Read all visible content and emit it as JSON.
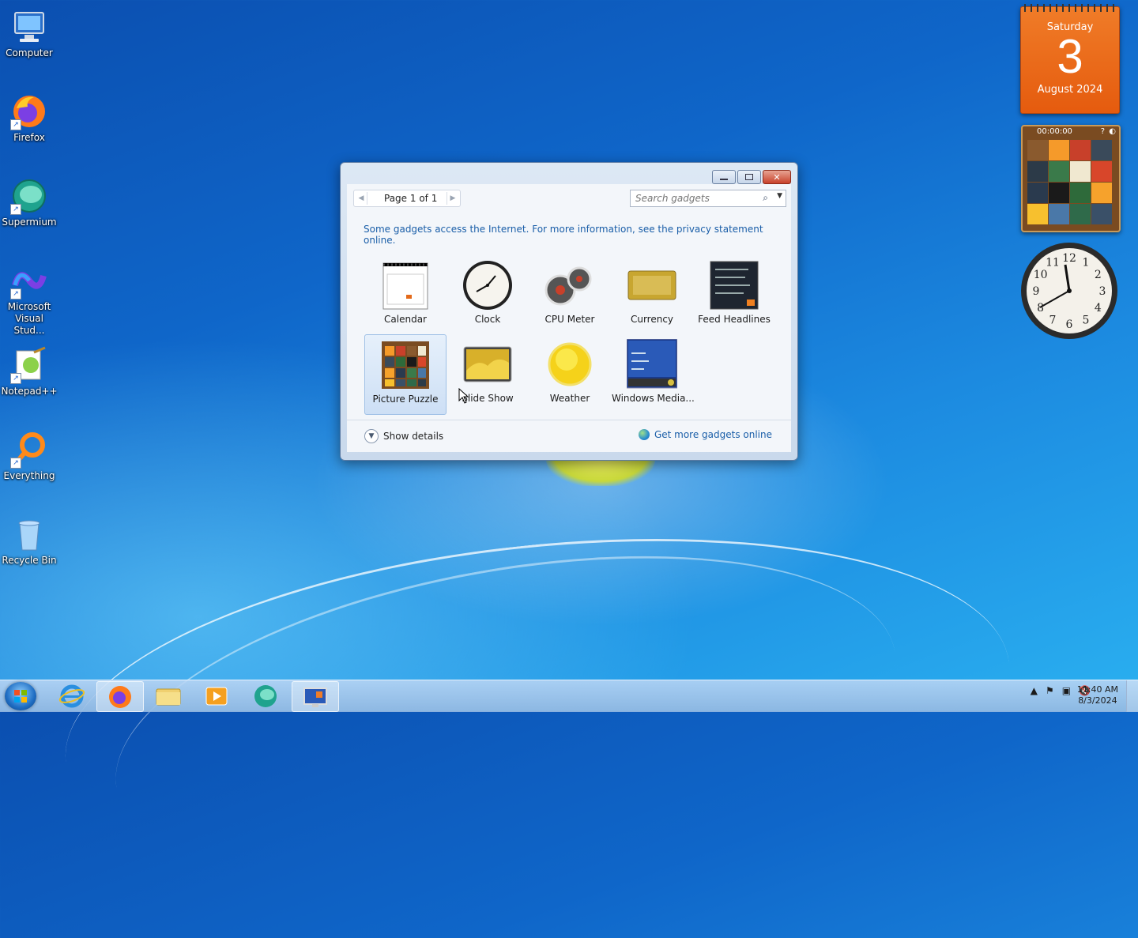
{
  "desktop": {
    "icons": [
      {
        "label": "Computer",
        "icon": "computer-icon"
      },
      {
        "label": "Firefox",
        "icon": "firefox-icon"
      },
      {
        "label": "Supermium",
        "icon": "supermium-icon"
      },
      {
        "label": "Microsoft Visual Stud...",
        "icon": "visual-studio-icon"
      },
      {
        "label": "Notepad++",
        "icon": "notepadpp-icon"
      },
      {
        "label": "Everything",
        "icon": "everything-icon"
      },
      {
        "label": "Recycle Bin",
        "icon": "recycle-bin-icon"
      }
    ]
  },
  "calendar_gadget": {
    "weekday": "Saturday",
    "day": "3",
    "month_year": "August 2024"
  },
  "puzzle_gadget": {
    "timer": "00:00:00"
  },
  "clock_gadget": {
    "numbers": [
      "12",
      "1",
      "2",
      "3",
      "4",
      "5",
      "6",
      "7",
      "8",
      "9",
      "10",
      "11"
    ]
  },
  "gadget_window": {
    "pager": {
      "text": "Page 1 of 1"
    },
    "search": {
      "placeholder": "Search gadgets"
    },
    "info": "Some gadgets access the Internet.  For more information, see the privacy statement online.",
    "gadgets": [
      {
        "label": "Calendar",
        "icon": "calendar-icon"
      },
      {
        "label": "Clock",
        "icon": "clock-icon"
      },
      {
        "label": "CPU Meter",
        "icon": "cpu-meter-icon"
      },
      {
        "label": "Currency",
        "icon": "currency-icon"
      },
      {
        "label": "Feed Headlines",
        "icon": "feed-headlines-icon"
      },
      {
        "label": "Picture Puzzle",
        "icon": "picture-puzzle-icon",
        "selected": true
      },
      {
        "label": "Slide Show",
        "icon": "slide-show-icon"
      },
      {
        "label": "Weather",
        "icon": "weather-icon"
      },
      {
        "label": "Windows Media...",
        "icon": "windows-media-icon"
      }
    ],
    "show_details": "Show details",
    "get_more": "Get more gadgets online"
  },
  "taskbar": {
    "clock_time": "11:40 AM",
    "clock_date": "8/3/2024",
    "items": [
      "start-button",
      "internet-explorer",
      "firefox",
      "file-explorer",
      "media-player",
      "supermium",
      "gadgets"
    ]
  }
}
